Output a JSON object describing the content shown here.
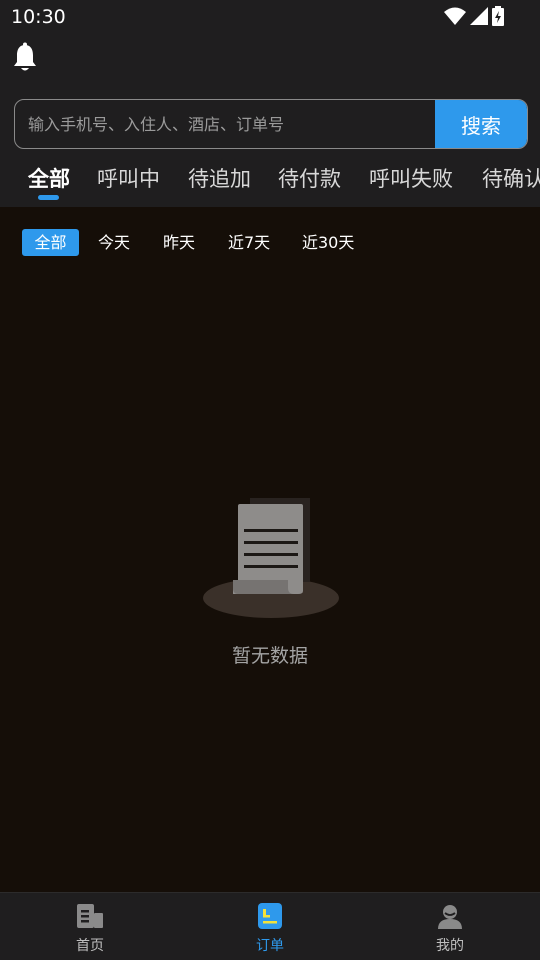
{
  "status_bar": {
    "time": "10:30"
  },
  "search": {
    "placeholder": "输入手机号、入住人、酒店、订单号",
    "value": "",
    "button_label": "搜索"
  },
  "order_tabs": [
    {
      "label": "全部",
      "active": true
    },
    {
      "label": "呼叫中",
      "active": false
    },
    {
      "label": "待追加",
      "active": false
    },
    {
      "label": "待付款",
      "active": false
    },
    {
      "label": "呼叫失败",
      "active": false
    },
    {
      "label": "待确认",
      "active": false
    }
  ],
  "date_filters": [
    {
      "label": "全部",
      "active": true
    },
    {
      "label": "今天",
      "active": false
    },
    {
      "label": "昨天",
      "active": false
    },
    {
      "label": "近7天",
      "active": false
    },
    {
      "label": "近30天",
      "active": false
    }
  ],
  "empty_state": {
    "text": "暂无数据",
    "icon": "empty-document-icon"
  },
  "bottom_nav": [
    {
      "label": "首页",
      "icon": "home-building-icon",
      "active": false
    },
    {
      "label": "订单",
      "icon": "order-list-icon",
      "active": true
    },
    {
      "label": "我的",
      "icon": "profile-person-icon",
      "active": false
    }
  ],
  "colors": {
    "accent": "#2e99ec",
    "header_bg": "#1f1e1f",
    "content_bg": "#150e08"
  }
}
